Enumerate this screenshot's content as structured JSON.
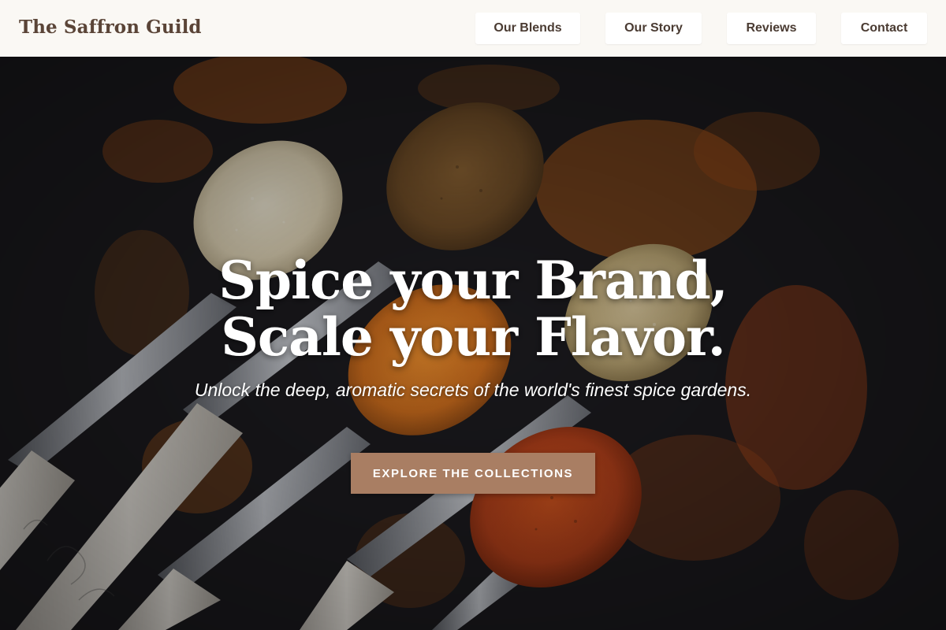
{
  "header": {
    "brand": "The Saffron Guild",
    "nav": [
      {
        "label": "Our Blends"
      },
      {
        "label": "Our Story"
      },
      {
        "label": "Reviews"
      },
      {
        "label": "Contact"
      }
    ]
  },
  "hero": {
    "title_line1": "Spice your Brand,",
    "title_line2": "Scale your Flavor.",
    "subtitle": "Unlock the deep, aromatic secrets of the world's finest spice gardens.",
    "cta_label": "EXPLORE THE COLLECTIONS",
    "background_image": "spice-spoons-photo"
  },
  "colors": {
    "header_bg": "#faf8f4",
    "brand_text": "#5a4437",
    "nav_text": "#4a3b32",
    "cta_bg": "#a97e63",
    "hero_text": "#ffffff"
  }
}
